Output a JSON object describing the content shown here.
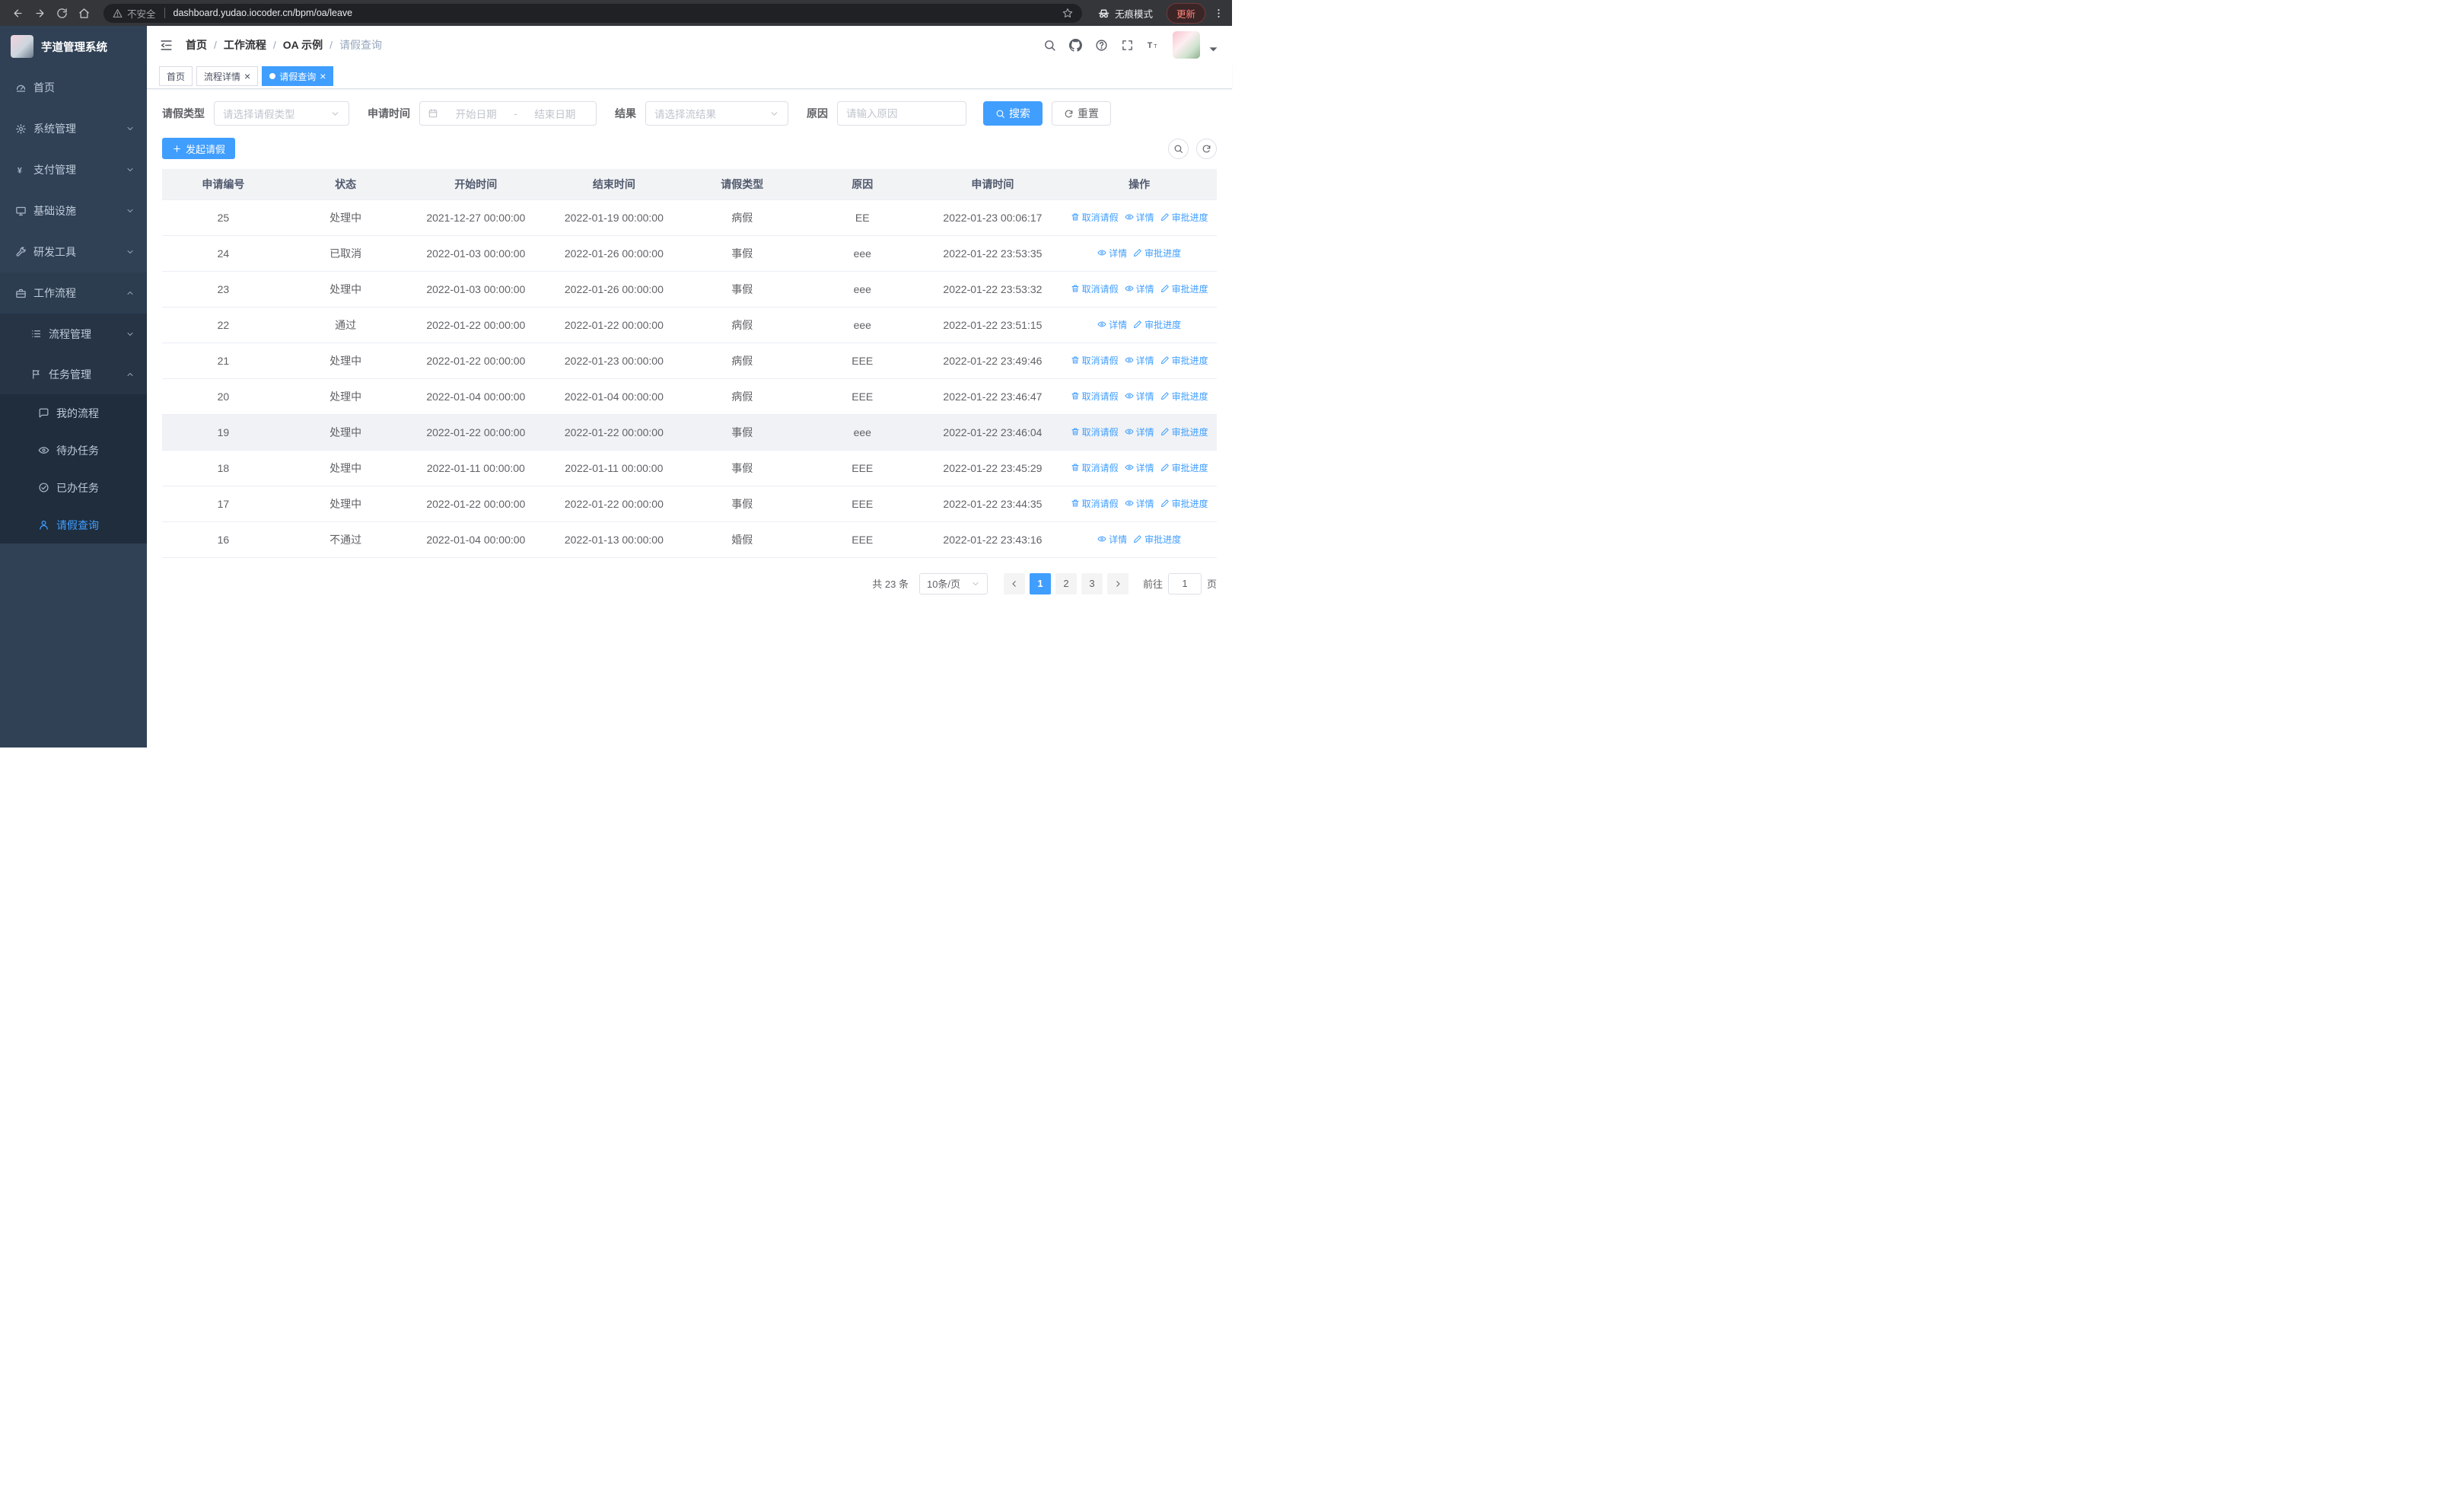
{
  "browser": {
    "security_warning": "不安全",
    "url": "dashboard.yudao.iocoder.cn/bpm/oa/leave",
    "incognito_label": "无痕模式",
    "update_label": "更新"
  },
  "sidebar": {
    "logo_title": "芋道管理系统",
    "items": [
      {
        "label": "首页",
        "icon": "dashboard-icon",
        "level": 0
      },
      {
        "label": "系统管理",
        "icon": "gear-icon",
        "level": 0,
        "chevron": "down"
      },
      {
        "label": "支付管理",
        "icon": "yen-icon",
        "level": 0,
        "chevron": "down"
      },
      {
        "label": "基础设施",
        "icon": "infrastructure-icon",
        "level": 0,
        "chevron": "down"
      },
      {
        "label": "研发工具",
        "icon": "tools-icon",
        "level": 0,
        "chevron": "down"
      },
      {
        "label": "工作流程",
        "icon": "workflow-icon",
        "level": 0,
        "chevron": "up",
        "open": true
      },
      {
        "label": "流程管理",
        "icon": "process-icon",
        "level": 1,
        "chevron": "down"
      },
      {
        "label": "任务管理",
        "icon": "task-icon",
        "level": 1,
        "chevron": "up",
        "open": true
      },
      {
        "label": "我的流程",
        "icon": "chat-icon",
        "level": 2
      },
      {
        "label": "待办任务",
        "icon": "eye-icon",
        "level": 2
      },
      {
        "label": "已办任务",
        "icon": "check-circle-icon",
        "level": 2
      },
      {
        "label": "请假查询",
        "icon": "user-icon",
        "level": 2,
        "active": true
      }
    ]
  },
  "header": {
    "breadcrumb": [
      "首页",
      "工作流程",
      "OA 示例",
      "请假查询"
    ]
  },
  "tabs": [
    {
      "label": "首页",
      "closable": false,
      "active": false
    },
    {
      "label": "流程详情",
      "closable": true,
      "active": false
    },
    {
      "label": "请假查询",
      "closable": true,
      "active": true
    }
  ],
  "filters": {
    "leave_type_label": "请假类型",
    "leave_type_placeholder": "请选择请假类型",
    "apply_time_label": "申请时间",
    "start_date_placeholder": "开始日期",
    "date_separator": "-",
    "end_date_placeholder": "结束日期",
    "result_label": "结果",
    "result_placeholder": "请选择流结果",
    "reason_label": "原因",
    "reason_placeholder": "请输入原因",
    "search_label": "搜索",
    "reset_label": "重置"
  },
  "toolbar": {
    "create_label": "发起请假"
  },
  "table": {
    "columns": [
      "申请编号",
      "状态",
      "开始时间",
      "结束时间",
      "请假类型",
      "原因",
      "申请时间",
      "操作"
    ],
    "action_labels": {
      "cancel": "取消请假",
      "detail": "详情",
      "progress": "审批进度"
    },
    "rows": [
      {
        "id": "25",
        "status": "处理中",
        "start_time": "2021-12-27 00:00:00",
        "end_time": "2022-01-19 00:00:00",
        "leave_type": "病假",
        "reason": "EE",
        "apply_time": "2022-01-23 00:06:17",
        "can_cancel": true,
        "highlighted": false
      },
      {
        "id": "24",
        "status": "已取消",
        "start_time": "2022-01-03 00:00:00",
        "end_time": "2022-01-26 00:00:00",
        "leave_type": "事假",
        "reason": "eee",
        "apply_time": "2022-01-22 23:53:35",
        "can_cancel": false,
        "highlighted": false
      },
      {
        "id": "23",
        "status": "处理中",
        "start_time": "2022-01-03 00:00:00",
        "end_time": "2022-01-26 00:00:00",
        "leave_type": "事假",
        "reason": "eee",
        "apply_time": "2022-01-22 23:53:32",
        "can_cancel": true,
        "highlighted": false
      },
      {
        "id": "22",
        "status": "通过",
        "start_time": "2022-01-22 00:00:00",
        "end_time": "2022-01-22 00:00:00",
        "leave_type": "病假",
        "reason": "eee",
        "apply_time": "2022-01-22 23:51:15",
        "can_cancel": false,
        "highlighted": false
      },
      {
        "id": "21",
        "status": "处理中",
        "start_time": "2022-01-22 00:00:00",
        "end_time": "2022-01-23 00:00:00",
        "leave_type": "病假",
        "reason": "EEE",
        "apply_time": "2022-01-22 23:49:46",
        "can_cancel": true,
        "highlighted": false
      },
      {
        "id": "20",
        "status": "处理中",
        "start_time": "2022-01-04 00:00:00",
        "end_time": "2022-01-04 00:00:00",
        "leave_type": "病假",
        "reason": "EEE",
        "apply_time": "2022-01-22 23:46:47",
        "can_cancel": true,
        "highlighted": false
      },
      {
        "id": "19",
        "status": "处理中",
        "start_time": "2022-01-22 00:00:00",
        "end_time": "2022-01-22 00:00:00",
        "leave_type": "事假",
        "reason": "eee",
        "apply_time": "2022-01-22 23:46:04",
        "can_cancel": true,
        "highlighted": true
      },
      {
        "id": "18",
        "status": "处理中",
        "start_time": "2022-01-11 00:00:00",
        "end_time": "2022-01-11 00:00:00",
        "leave_type": "事假",
        "reason": "EEE",
        "apply_time": "2022-01-22 23:45:29",
        "can_cancel": true,
        "highlighted": false
      },
      {
        "id": "17",
        "status": "处理中",
        "start_time": "2022-01-22 00:00:00",
        "end_time": "2022-01-22 00:00:00",
        "leave_type": "事假",
        "reason": "EEE",
        "apply_time": "2022-01-22 23:44:35",
        "can_cancel": true,
        "highlighted": false
      },
      {
        "id": "16",
        "status": "不通过",
        "start_time": "2022-01-04 00:00:00",
        "end_time": "2022-01-13 00:00:00",
        "leave_type": "婚假",
        "reason": "EEE",
        "apply_time": "2022-01-22 23:43:16",
        "can_cancel": false,
        "highlighted": false
      }
    ]
  },
  "pagination": {
    "total_label": "共 23 条",
    "page_size_label": "10条/页",
    "pages": [
      "1",
      "2",
      "3"
    ],
    "current": "1",
    "goto_label": "前往",
    "goto_value": "1",
    "page_unit_label": "页"
  },
  "colors": {
    "accent": "#409eff",
    "sidebar_bg": "#304156",
    "active_tab_bg": "#409eff"
  }
}
